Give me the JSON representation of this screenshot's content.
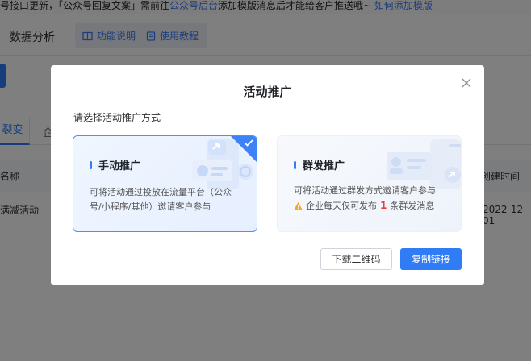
{
  "notice": {
    "text_1": "号接口更新，「公众号回复文案」需前往",
    "link_1": "公众号后台",
    "text_2": "添加模版消息后才能给客户推送哦~",
    "link_2": "如何添加模版"
  },
  "header": {
    "title": "数据分析",
    "feature_desc": "功能说明",
    "tutorial": "使用教程"
  },
  "tabs": {
    "active": "裂变",
    "second": "企"
  },
  "table": {
    "header_left": "名称",
    "header_right": "创建时间",
    "row_left": "满减活动",
    "row_right": "2022-12-01"
  },
  "modal": {
    "title": "活动推广",
    "subtitle": "请选择活动推广方式",
    "manual": {
      "title": "手动推广",
      "desc": "可将活动通过投放在流量平台（公众号/小程序/其他）邀请客户参与"
    },
    "mass": {
      "title": "群发推广",
      "desc": "可将活动通过群发方式邀请客户参与",
      "warn_prefix": "企业每天仅可发布",
      "warn_num": "1",
      "warn_suffix": "条群发消息"
    },
    "download_btn": "下载二维码",
    "copy_btn": "复制链接"
  },
  "icons": [
    "close-icon",
    "check-icon",
    "warning-icon",
    "book-icon",
    "tutorial-icon",
    "share-icon"
  ],
  "colors": {
    "primary": "#2f7cf6",
    "warning": "#f5a623",
    "danger": "#e63c3c"
  }
}
